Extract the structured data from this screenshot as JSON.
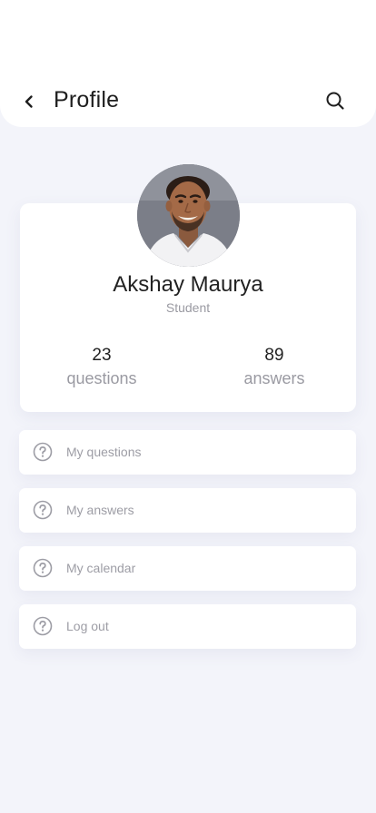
{
  "header": {
    "title": "Profile",
    "back_icon": "chevron-left-icon",
    "search_icon": "search-icon"
  },
  "profile": {
    "name": "Akshay Maurya",
    "role": "Student",
    "avatar_icon": "user-photo",
    "stats": [
      {
        "value": "23",
        "label": "questions"
      },
      {
        "value": "89",
        "label": "answers"
      }
    ]
  },
  "menu": {
    "items": [
      {
        "label": "My questions",
        "icon": "help-circle-icon"
      },
      {
        "label": "My answers",
        "icon": "help-circle-icon"
      },
      {
        "label": "My calendar",
        "icon": "help-circle-icon"
      },
      {
        "label": "Log out",
        "icon": "help-circle-icon"
      }
    ]
  },
  "colors": {
    "background": "#f3f4fa",
    "surface": "#ffffff",
    "text_primary": "#222222",
    "text_muted": "#9a9aa2"
  }
}
